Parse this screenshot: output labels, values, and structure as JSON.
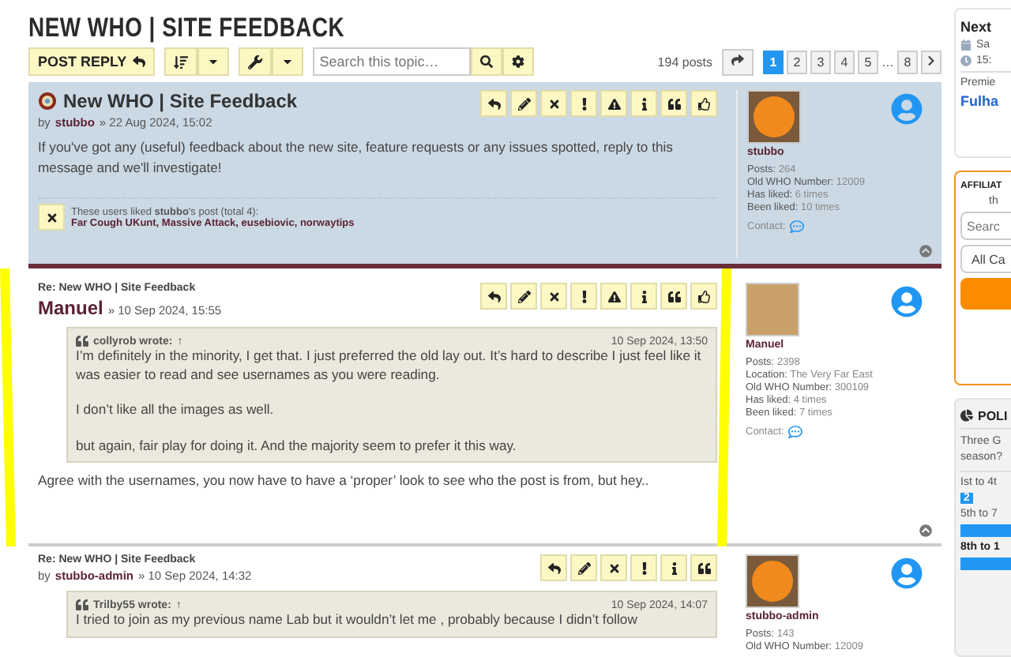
{
  "page_title": "NEW WHO | SITE FEEDBACK",
  "toolbar": {
    "post_reply": "POST REPLY",
    "search": {
      "placeholder": "Search this topic…"
    },
    "post_count": "194 posts",
    "pages": [
      {
        "label": "1",
        "selected": true
      },
      {
        "label": "2",
        "selected": false
      },
      {
        "label": "3",
        "selected": false
      },
      {
        "label": "4",
        "selected": false
      },
      {
        "label": "5",
        "selected": false
      },
      {
        "label": "…",
        "kind": "gap"
      },
      {
        "label": "8",
        "selected": false
      }
    ]
  },
  "posts": [
    {
      "kind": "topic",
      "title": "New WHO | Site Feedback",
      "byline": {
        "prefix": "by",
        "author": "stubbo",
        "date": "» 22 Aug 2024, 15:02",
        "large": false
      },
      "actions": [
        {
          "kind": "reply"
        },
        {
          "kind": "edit"
        },
        {
          "kind": "delete"
        },
        {
          "kind": "report"
        },
        {
          "kind": "warn"
        },
        {
          "kind": "info"
        },
        {
          "kind": "quote"
        },
        {
          "kind": "like"
        }
      ],
      "body": [
        "If you've got any (useful) feedback about the new site, feature requests or any issues spotted, reply to this message and we'll investigate!"
      ],
      "likes": {
        "summary": "These users liked **stubbo**'s post (total 4):",
        "users": "Far Cough UKunt, Massive Attack, eusebiovic, norwaytips"
      },
      "profile": {
        "avatar": {
          "kind": "ball"
        },
        "username": "stubbo",
        "stats": [
          {
            "label": "Posts:",
            "value": "264"
          },
          {
            "label": "Old WHO Number:",
            "value": "12009"
          },
          {
            "label": "Has liked:",
            "value": "6 times"
          },
          {
            "label": "Been liked:",
            "value": "10 times"
          }
        ],
        "contact": "Contact:"
      }
    },
    {
      "kind": "reply",
      "title": "Re: New WHO | Site Feedback",
      "byline": {
        "author": "Manuel",
        "date": "» 10 Sep 2024, 15:55",
        "large": true
      },
      "actions": [
        {
          "kind": "reply"
        },
        {
          "kind": "edit"
        },
        {
          "kind": "delete"
        },
        {
          "kind": "report"
        },
        {
          "kind": "warn"
        },
        {
          "kind": "info"
        },
        {
          "kind": "quote"
        },
        {
          "kind": "like"
        }
      ],
      "quote": {
        "author": "collyrob wrote:",
        "jump": "↑",
        "date": "10 Sep 2024, 13:50",
        "paragraphs": [
          "I’m definitely in the minority, I get that. I just preferred the old lay out. It’s hard to describe I just feel like it was easier to read and see usernames as you were reading.",
          "I don’t like all the images as well.",
          "but again, fair play for doing it. And the majority seem to prefer it this way."
        ]
      },
      "body": [
        "Agree with the usernames, you now have to have a ‘proper’ look to see who the post is from, but hey.."
      ],
      "profile": {
        "avatar": {
          "kind": "photo"
        },
        "username": "Manuel",
        "stats": [
          {
            "label": "Posts:",
            "value": "2398"
          },
          {
            "label": "Location:",
            "value": "The Very Far East"
          },
          {
            "label": "Old WHO Number:",
            "value": "300109"
          },
          {
            "label": "Has liked:",
            "value": "4 times"
          },
          {
            "label": "Been liked:",
            "value": "7 times"
          }
        ],
        "contact": "Contact:"
      }
    },
    {
      "kind": "reply",
      "title": "Re: New WHO | Site Feedback",
      "byline": {
        "prefix": "by",
        "author": "stubbo-admin",
        "date": "» 10 Sep 2024, 14:32",
        "large": false
      },
      "actions": [
        {
          "kind": "reply"
        },
        {
          "kind": "edit"
        },
        {
          "kind": "delete"
        },
        {
          "kind": "report"
        },
        {
          "kind": "info"
        },
        {
          "kind": "quote"
        }
      ],
      "quote": {
        "author": "Trilby55 wrote:",
        "jump": "↑",
        "date": "10 Sep 2024, 14:07",
        "paragraphs": [
          "I tried to join as my previous name Lab but it wouldn’t let me , probably because I didn’t follow"
        ]
      },
      "profile": {
        "avatar": {
          "kind": "ball"
        },
        "username": "stubbo-admin",
        "stats": [
          {
            "label": "Posts:",
            "value": "143"
          },
          {
            "label": "Old WHO Number:",
            "value": "12009"
          }
        ]
      }
    }
  ],
  "sidebar": {
    "next_match": {
      "title": "Next",
      "date": "Sa",
      "time": "15:",
      "competition": "Premie",
      "fixture": "Fulha"
    },
    "affiliate": {
      "title": "AFFILIAT",
      "subtitle": "th",
      "search": {
        "placeholder": "Searc"
      },
      "category": "All Ca"
    },
    "poll": {
      "title": "POLI",
      "question": "Three G season?",
      "options": [
        {
          "label": "Ist to 4t",
          "votes": "2"
        },
        {
          "label": "5th to 7",
          "level": 1
        },
        {
          "label": "8th to 1",
          "level": 1,
          "bold": true
        }
      ]
    }
  }
}
